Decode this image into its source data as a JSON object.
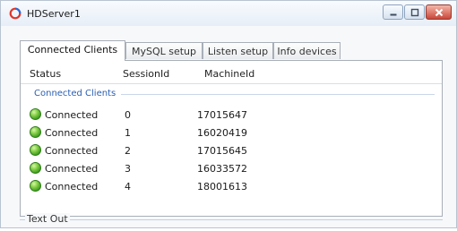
{
  "window": {
    "title": "HDServer1",
    "icon": "app-ring-icon"
  },
  "tabs": [
    {
      "label": "Connected Clients",
      "active": true
    },
    {
      "label": "MySQL setup",
      "active": false
    },
    {
      "label": "Listen setup",
      "active": false
    },
    {
      "label": "Info devices",
      "active": false
    }
  ],
  "table": {
    "columns": [
      "Status",
      "SessionId",
      "MachineId"
    ],
    "group_label": "Connected Clients",
    "rows": [
      {
        "status": "Connected",
        "session": "0",
        "machine": "17015647"
      },
      {
        "status": "Connected",
        "session": "1",
        "machine": "16020419"
      },
      {
        "status": "Connected",
        "session": "2",
        "machine": "17015645"
      },
      {
        "status": "Connected",
        "session": "3",
        "machine": "16033572"
      },
      {
        "status": "Connected",
        "session": "4",
        "machine": "18001613"
      }
    ]
  },
  "textout": {
    "label": "Text Out"
  },
  "colors": {
    "connected": "#4caf2a",
    "group_text": "#2b5fb3",
    "close_button": "#c9473a"
  }
}
